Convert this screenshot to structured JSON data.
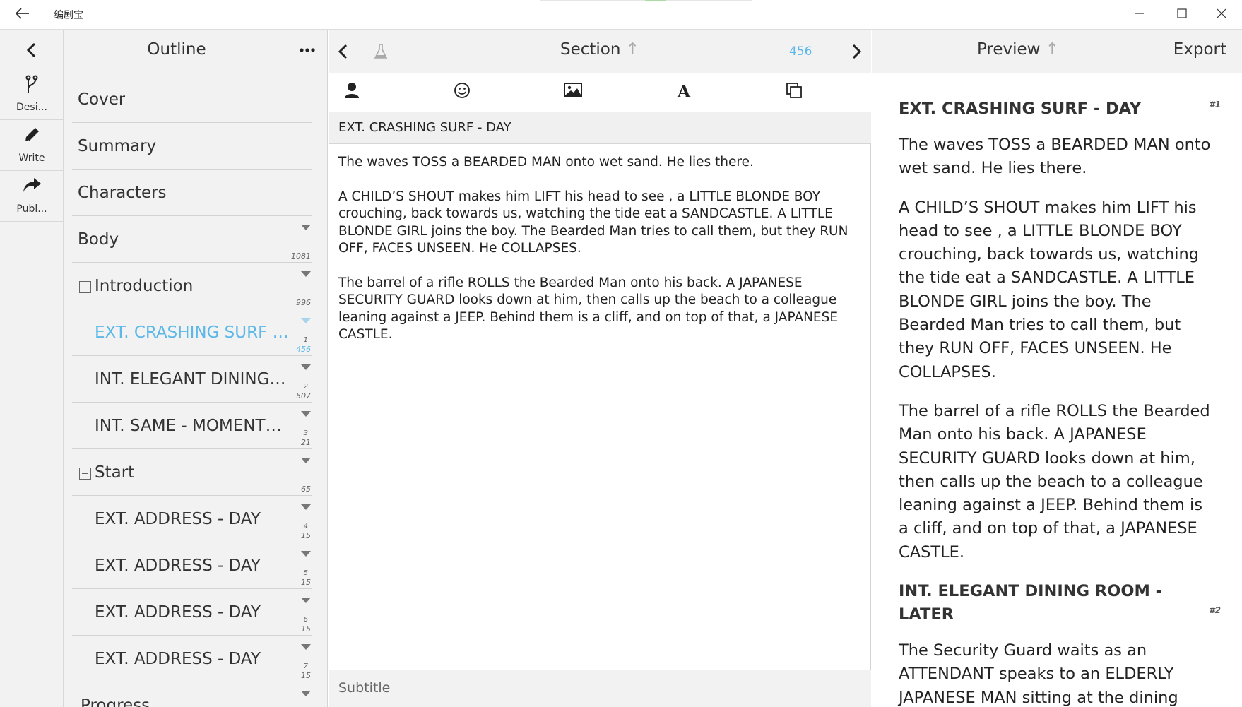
{
  "window": {
    "title": "编剧宝",
    "back_icon": "arrow-left-icon",
    "controls": {
      "minimize": "─",
      "maximize": "☐",
      "close": "✕"
    }
  },
  "rail": {
    "items": [
      {
        "label": "Desi...",
        "icon": "branch-icon"
      },
      {
        "label": "Write",
        "icon": "pencil-icon"
      },
      {
        "label": "Publ...",
        "icon": "share-icon"
      }
    ]
  },
  "outline": {
    "title": "Outline",
    "rows": [
      {
        "label": "Cover"
      },
      {
        "label": "Summary"
      },
      {
        "label": "Characters"
      },
      {
        "label": "Body",
        "count": "1081"
      },
      {
        "label": "Introduction",
        "count": "996"
      },
      {
        "label": "EXT. CRASHING SURF - DAY",
        "num": "1",
        "count": "456",
        "active": true
      },
      {
        "label": "INT. ELEGANT DINING ROOM - LATER",
        "num": "2",
        "count": "507"
      },
      {
        "label": "INT. SAME - MOMENTS LATER",
        "num": "3",
        "count": "21"
      },
      {
        "label": "Start",
        "count": "65"
      },
      {
        "label": "EXT. ADDRESS - DAY",
        "num": "4",
        "count": "15"
      },
      {
        "label": "EXT. ADDRESS - DAY",
        "num": "5",
        "count": "15"
      },
      {
        "label": "EXT. ADDRESS - DAY",
        "num": "6",
        "count": "15"
      },
      {
        "label": "EXT. ADDRESS - DAY",
        "num": "7",
        "count": "15"
      },
      {
        "label": "Progress"
      }
    ]
  },
  "editor": {
    "title": "Section",
    "title_arrow": "↑",
    "word_count": "456",
    "slugline": "EXT. CRASHING SURF - DAY",
    "paragraphs": [
      "The waves TOSS a BEARDED MAN onto wet sand. He lies there.",
      "A CHILD’S SHOUT makes him LIFT his head to see , a LITTLE BLONDE BOY crouching, back towards us, watching the tide eat a SANDCASTLE. A LITTLE BLONDE GIRL joins the boy. The Bearded Man tries to call them, but they RUN OFF, FACES UNSEEN. He COLLAPSES.",
      "The barrel of a rifle ROLLS the Bearded Man onto his back. A JAPANESE SECURITY GUARD looks down at him, then calls up the beach to a colleague leaning against a JEEP. Behind them is a cliff, and on top of that, a JAPANESE CASTLE."
    ],
    "subtitle_placeholder": "Subtitle",
    "toolbar_icons": [
      "person-icon",
      "smiley-icon",
      "image-icon",
      "font-icon",
      "copy-icon"
    ]
  },
  "preview": {
    "title": "Preview",
    "title_arrow": "↑",
    "export_label": "Export",
    "scene1": {
      "heading": "EXT. CRASHING SURF - DAY",
      "number": "#1",
      "paragraphs": [
        "The waves TOSS a BEARDED MAN onto wet sand. He lies there.",
        "A CHILD’S SHOUT makes him LIFT his head to see , a LITTLE BLONDE BOY crouching, back towards us, watching the tide eat a SANDCASTLE. A LITTLE BLONDE GIRL joins the boy. The Bearded Man tries to call them, but they RUN OFF, FACES UNSEEN. He COLLAPSES.",
        "The barrel of a rifle ROLLS the Bearded Man onto his back. A JAPANESE SECURITY GUARD looks down at him, then calls up the beach to a colleague leaning against a JEEP. Behind them is a cliff, and on top of that, a JAPANESE CASTLE."
      ]
    },
    "scene2": {
      "heading": "INT. ELEGANT DINING ROOM - LATER",
      "number": "#2",
      "paragraphs": [
        "The Security Guard waits as an ATTENDANT speaks to an ELDERLY JAPANESE MAN sitting at the dining"
      ]
    }
  },
  "colors": {
    "accent": "#5bb8e8",
    "panel_bg": "#f2f2f2",
    "divider": "#d2d2d2"
  }
}
